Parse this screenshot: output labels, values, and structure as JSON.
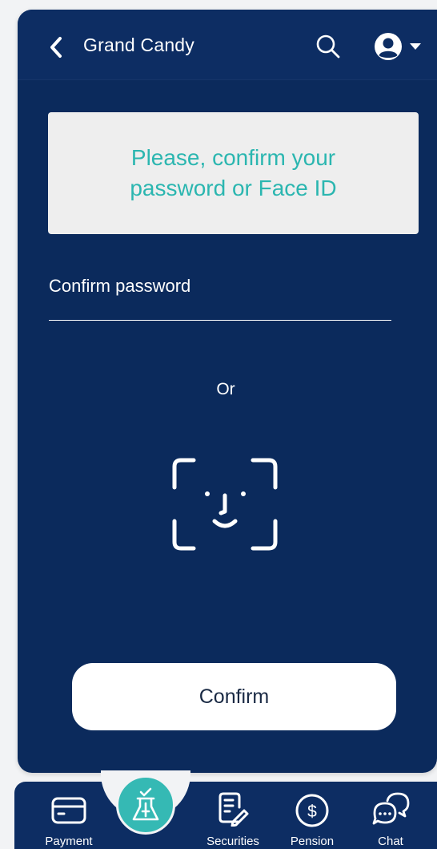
{
  "header": {
    "title": "Grand Candy",
    "back_icon": "chevron-left-icon",
    "search_icon": "search-icon",
    "profile_icon": "user-circle-icon",
    "dropdown_icon": "caret-down-icon"
  },
  "notice": {
    "text": "Please, confirm your password or Face ID"
  },
  "password": {
    "label": "Confirm password",
    "value": "",
    "placeholder": ""
  },
  "or_text": "Or",
  "face_id_icon": "face-id-icon",
  "confirm_label": "Confirm",
  "tabbar": {
    "items": [
      {
        "label": "Payment",
        "icon": "credit-card-icon"
      },
      {
        "label": "",
        "icon": "invest-flask-icon"
      },
      {
        "label": "Securities",
        "icon": "document-pen-icon"
      },
      {
        "label": "Pension",
        "icon": "dollar-circle-icon"
      },
      {
        "label": "Chat",
        "icon": "chat-bubbles-icon"
      }
    ]
  },
  "colors": {
    "background": "#0b2a5c",
    "accent": "#2bb6b0",
    "notice_bg": "#eeeeee",
    "button_bg": "#ffffff"
  }
}
